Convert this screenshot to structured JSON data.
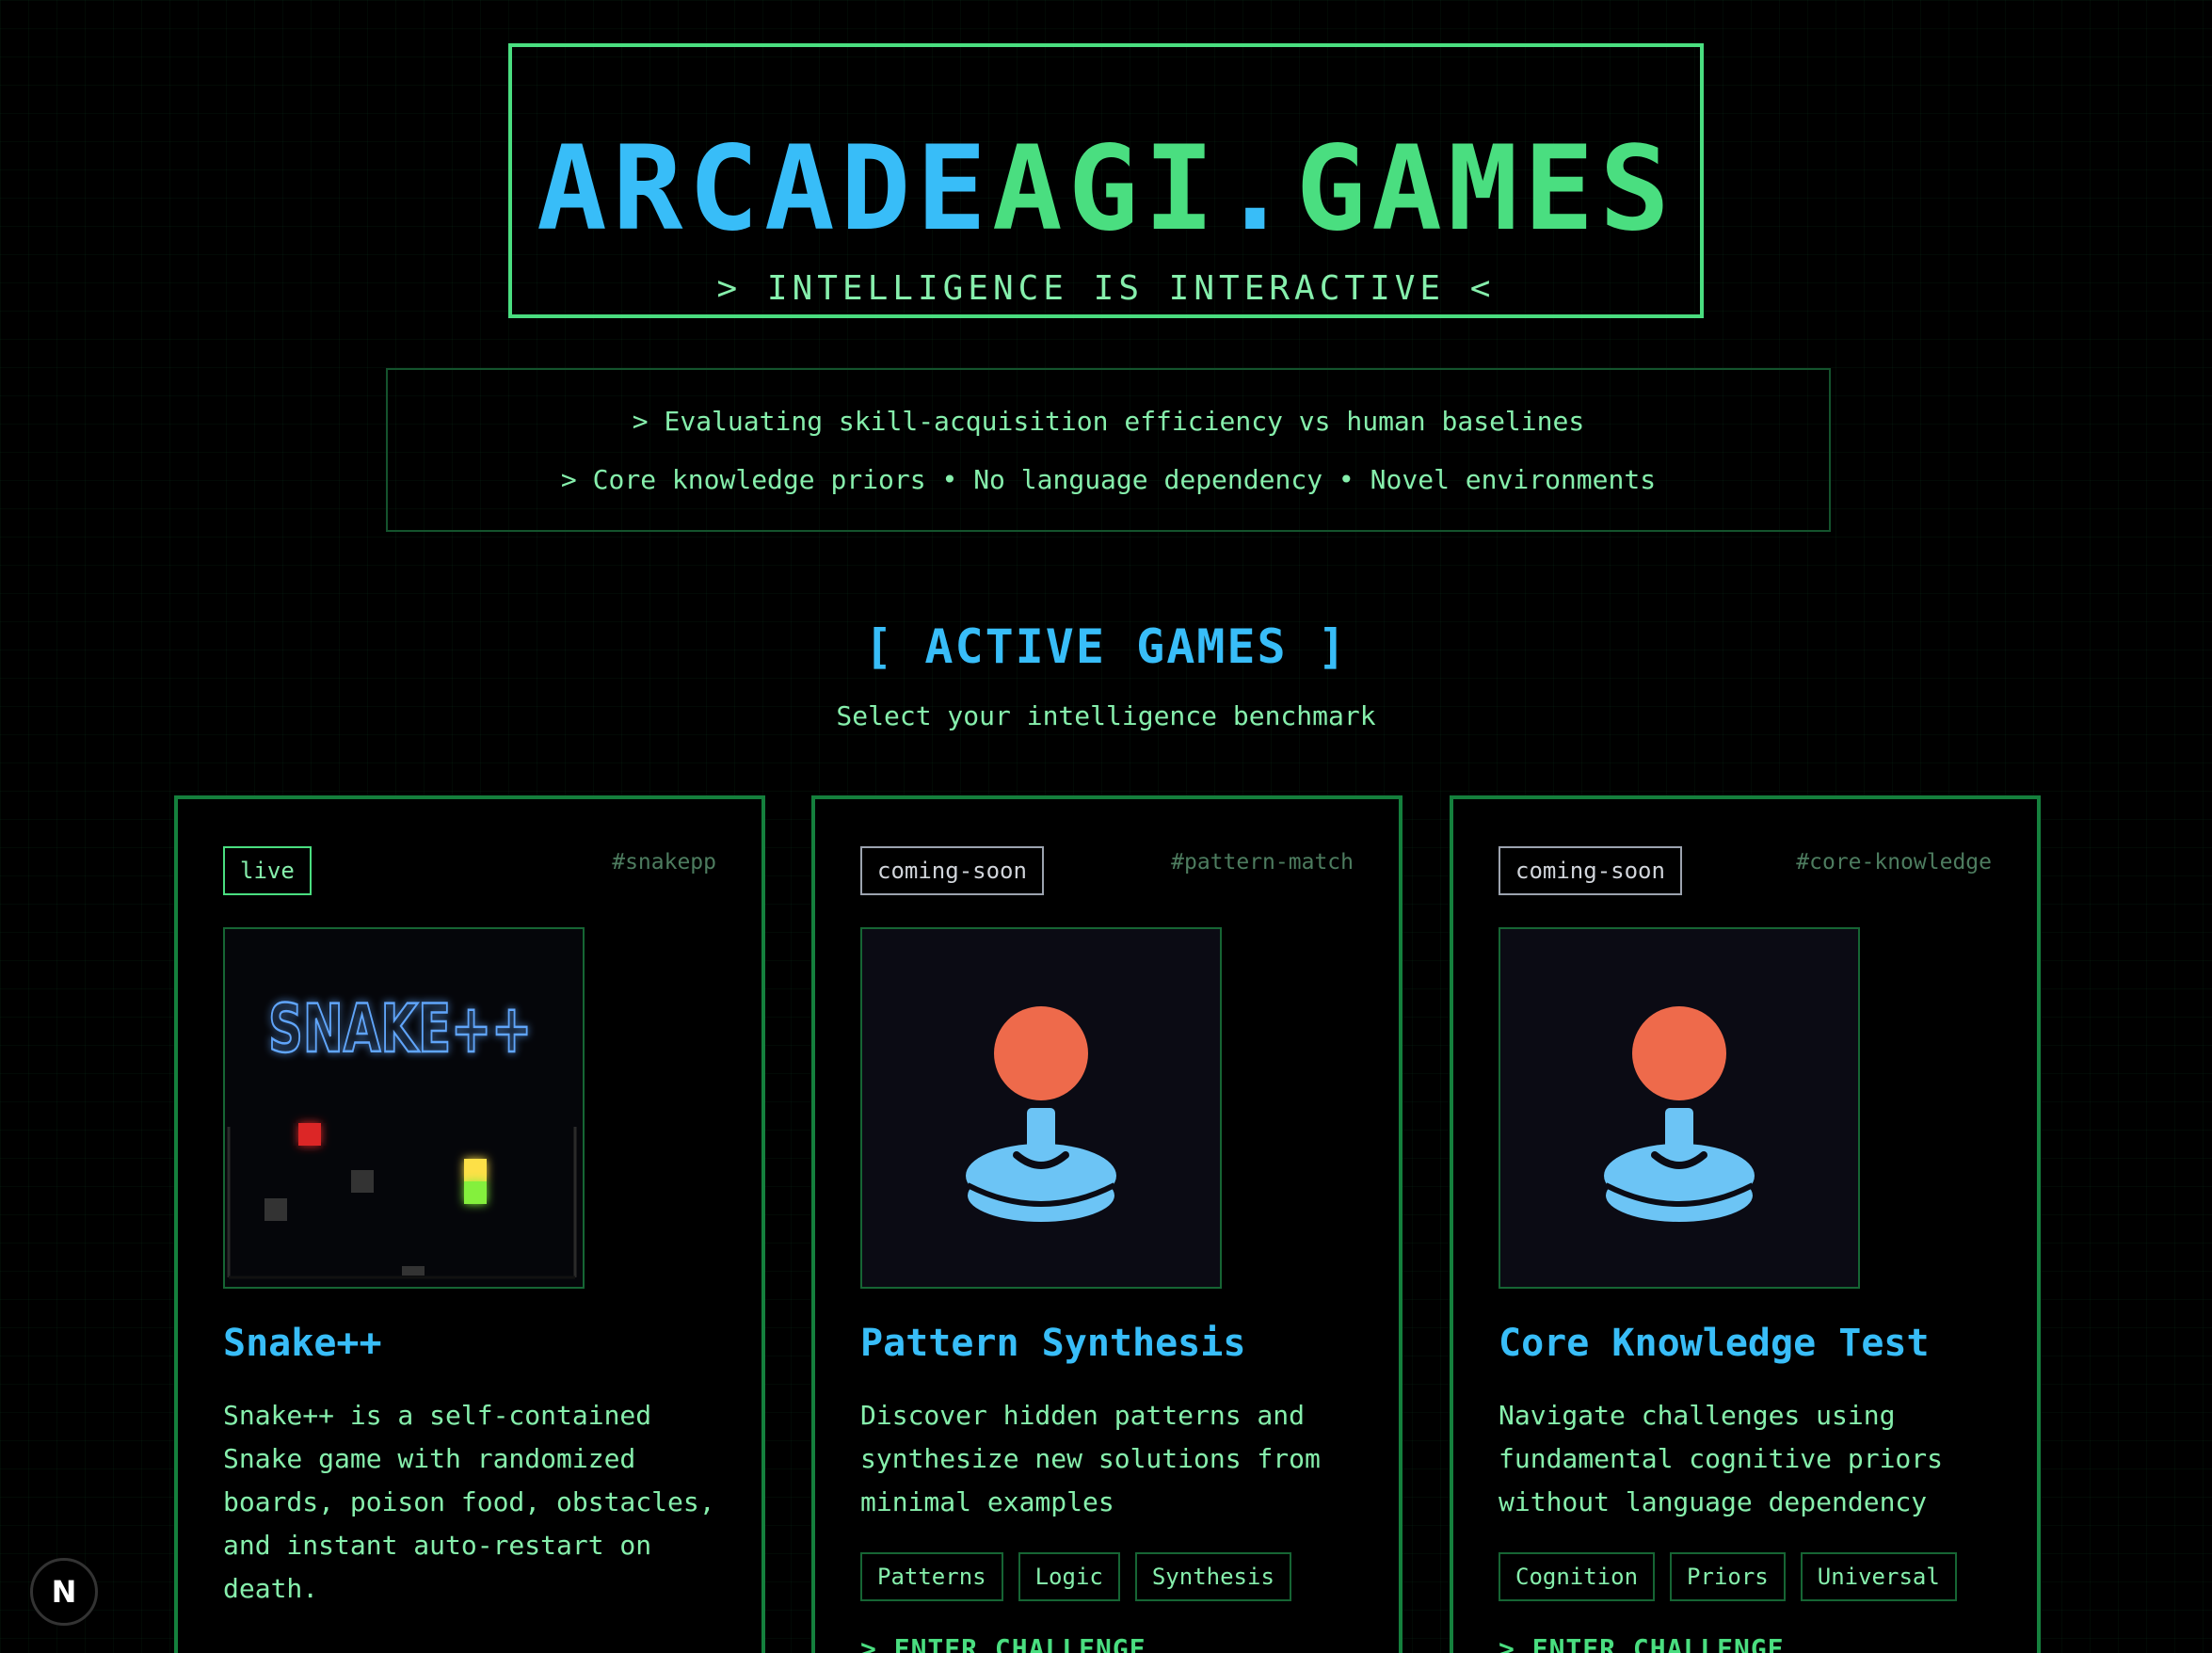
{
  "header": {
    "title_part1": "ARCADE",
    "title_part2": "AGI",
    "title_part3": ".",
    "title_part4": "GAMES",
    "tagline": "> INTELLIGENCE IS INTERACTIVE <"
  },
  "info": {
    "line1": "> Evaluating skill-acquisition efficiency vs human baselines",
    "line2": "> Core knowledge priors • No language dependency • Novel environments"
  },
  "section": {
    "title": "[ ACTIVE GAMES ]",
    "subtitle": "Select your intelligence benchmark"
  },
  "cards": [
    {
      "status": "live",
      "hash": "#snakepp",
      "thumb_text": "SNAKE++",
      "title": "Snake++",
      "description": "Snake++ is a self-contained Snake game with randomized boards, poison food, obstacles, and instant auto-restart on death."
    },
    {
      "status": "coming-soon",
      "hash": "#pattern-match",
      "title": "Pattern Synthesis",
      "description": "Discover hidden patterns and synthesize new solutions from minimal examples",
      "tags": [
        "Patterns",
        "Logic",
        "Synthesis"
      ],
      "cta": "> ENTER CHALLENGE"
    },
    {
      "status": "coming-soon",
      "hash": "#core-knowledge",
      "title": "Core Knowledge Test",
      "description": "Navigate challenges using fundamental cognitive priors without language dependency",
      "tags": [
        "Cognition",
        "Priors",
        "Universal"
      ],
      "cta": "> ENTER CHALLENGE"
    }
  ],
  "next_badge": "N",
  "colors": {
    "accent_blue": "#38bdf8",
    "accent_green": "#4ade80",
    "text_green": "#86efac",
    "joystick_ball": "#ee6a4b",
    "joystick_base": "#6cc4f5"
  }
}
